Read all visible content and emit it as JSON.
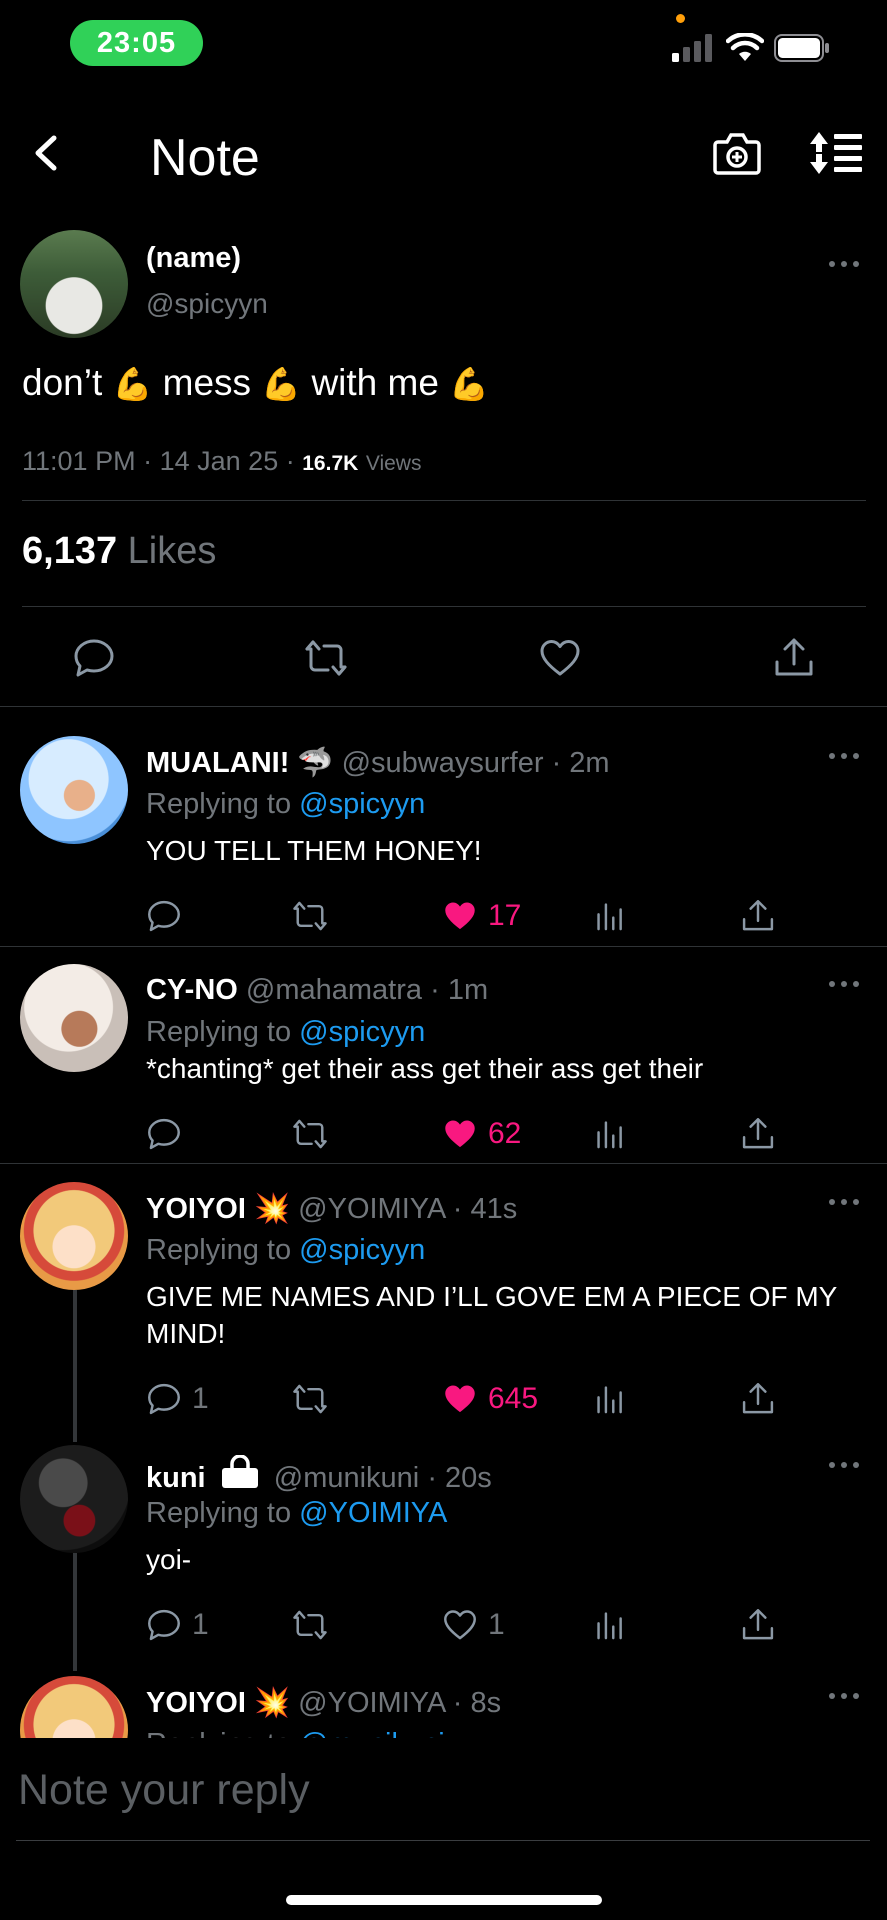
{
  "status_bar": {
    "time": "23:05"
  },
  "header": {
    "title": "Note"
  },
  "main_post": {
    "name": "(name)",
    "handle": "@spicyyn",
    "text_parts": [
      "don’t",
      "mess",
      "with me"
    ],
    "emoji": "💪",
    "time": "11:01 PM",
    "date": "14 Jan 25",
    "separator": "·",
    "views_count": "16.7K",
    "views_label": "Views",
    "likes_count": "6,137",
    "likes_label": "Likes"
  },
  "replies": [
    {
      "name": "MUALANI!",
      "name_emoji": "🦈",
      "handle": "@subwaysurfer",
      "time": "2m",
      "replying_label": "Replying to",
      "replying_to": "@spicyyn",
      "text": "YOU TELL THEM HONEY!",
      "comments": "",
      "likes": "17",
      "liked": true
    },
    {
      "name": "CY-NO",
      "name_emoji": "",
      "handle": "@mahamatra",
      "time": "1m",
      "replying_label": "Replying to",
      "replying_to": "@spicyyn",
      "text": "*chanting* get their ass get their ass get their",
      "comments": "",
      "likes": "62",
      "liked": true
    },
    {
      "name": "YOIYOI",
      "name_emoji": "💥",
      "handle": "@YOIMIYA",
      "time": "41s",
      "replying_label": "Replying to",
      "replying_to": "@spicyyn",
      "text": "GIVE ME NAMES AND I’LL GOVE EM A PIECE OF MY MIND!",
      "comments": "1",
      "likes": "645",
      "liked": true
    },
    {
      "name": "kuni",
      "name_emoji": "",
      "handle": "@munikuni",
      "time": "20s",
      "replying_label": "Replying to",
      "replying_to": "@YOIMIYA",
      "text": "yoi-",
      "comments": "1",
      "likes": "1",
      "liked": false
    },
    {
      "name": "YOIYOI",
      "name_emoji": "💥",
      "handle": "@YOIMIYA",
      "time": "8s",
      "replying_label": "Replying to",
      "replying_to": "@munikuni",
      "text": "",
      "comments": "",
      "likes": "",
      "liked": false
    }
  ],
  "composer": {
    "placeholder": "Note your reply"
  },
  "colors": {
    "background": "#000000",
    "text_primary": "#e7e9ea",
    "text_secondary": "#71767b",
    "accent_blue": "#1d9bf0",
    "like_pink": "#f91880",
    "time_pill_green": "#30d158"
  },
  "icons": {
    "back": "chevron-left-icon",
    "camera": "camera-icon",
    "sort": "sort-icon",
    "more": "ellipsis-icon",
    "reply": "reply-bubble-icon",
    "retweet": "retweet-icon",
    "like": "heart-icon",
    "views": "bar-chart-icon",
    "share": "share-icon",
    "lock": "lock-icon"
  }
}
